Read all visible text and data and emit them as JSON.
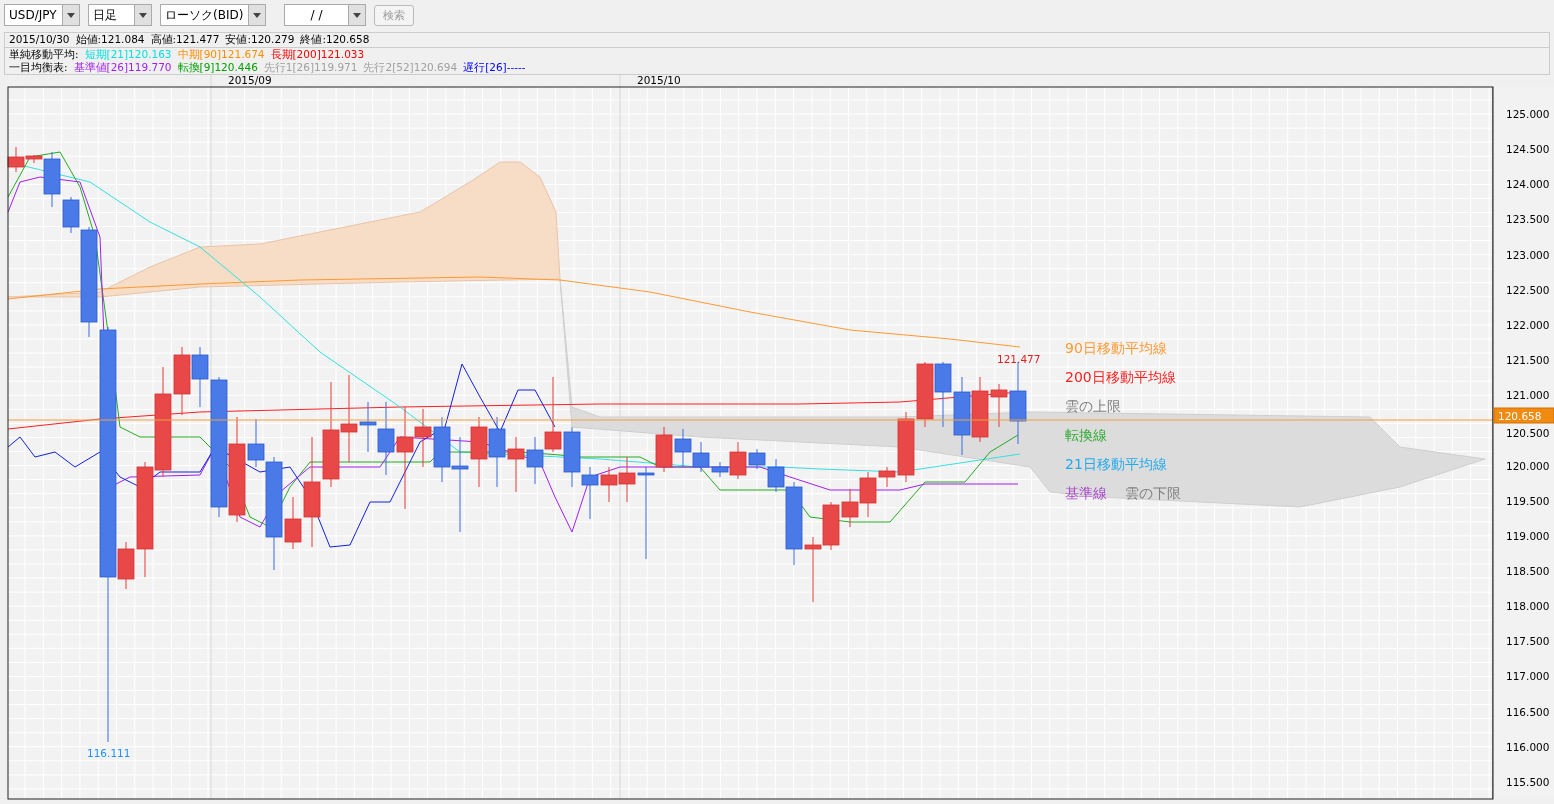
{
  "toolbar": {
    "selects": [
      {
        "value": "USD/JPY"
      },
      {
        "value": "日足"
      },
      {
        "value": "ローソク(BID)"
      },
      {
        "value": "/ /"
      }
    ],
    "search_button": {
      "label": "検索",
      "disabled": true
    }
  },
  "info": {
    "ohlc": [
      "2015/10/30",
      "始値:121.084",
      "高値:121.477",
      "安値:120.279",
      "終値:120.658"
    ],
    "sma": {
      "label": "単純移動平均:",
      "items": [
        {
          "text": "短期[21]120.163",
          "color": "#00e0e0"
        },
        {
          "text": "中期[90]121.674",
          "color": "#ff8c00"
        },
        {
          "text": "長期[200]121.033",
          "color": "#ff0000"
        }
      ]
    },
    "ichimoku": {
      "label": "一目均衡表:",
      "items": [
        {
          "text": "基準値[26]119.770",
          "color": "#a020f0"
        },
        {
          "text": "転換[9]120.446",
          "color": "#00a000"
        },
        {
          "text": "先行1[26]119.971",
          "color": "#a0a0a0"
        },
        {
          "text": "先行2[52]120.694",
          "color": "#a0a0a0"
        },
        {
          "text": "遅行[26]-----",
          "color": "#0000ff"
        }
      ]
    }
  },
  "chart": {
    "months": [
      "2015/09",
      "2015/10"
    ],
    "y_ticks": [
      "125.000",
      "124.500",
      "124.000",
      "123.500",
      "123.000",
      "122.500",
      "122.000",
      "121.500",
      "121.000",
      "120.500",
      "120.000",
      "119.500",
      "119.000",
      "118.500",
      "118.000",
      "117.500",
      "117.000",
      "116.500",
      "116.000",
      "115.500"
    ],
    "current_price": "120.658",
    "high_label": "121.477",
    "low_label": "116.111",
    "legend": [
      {
        "text": "90日移動平均線",
        "color": "#ff9933"
      },
      {
        "text": "200日移動平均線",
        "color": "#ff2020"
      },
      {
        "text": "雲の上限",
        "color": "#808080"
      },
      {
        "text": "転換線",
        "color": "#33aa33"
      },
      {
        "text": "21日移動平均線",
        "color": "#22aaee"
      },
      {
        "text": "基準線",
        "color": "#aa44cc"
      },
      {
        "text": "雲の下限",
        "color": "#808080"
      }
    ]
  }
}
